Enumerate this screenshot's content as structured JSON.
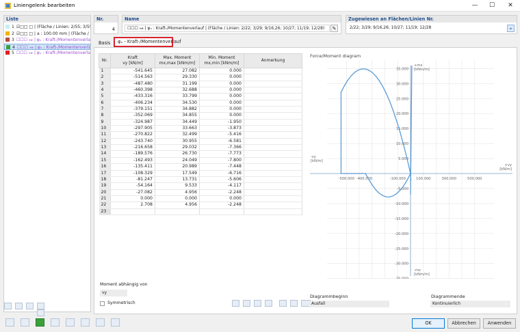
{
  "window": {
    "title": "Liniengelenk bearbeiten",
    "minimize": "—",
    "maximize": "☐",
    "close": "✕"
  },
  "liste": {
    "header": "Liste",
    "items": [
      {
        "nr": "1",
        "text": "☑□□ □ | (Fläche / Linien: 2/55; 3/55; 3/55",
        "color": "#c8f0f0",
        "purple": false
      },
      {
        "nr": "2",
        "text": "☑□□ □ | a : 100.00 mm | (Fläche / Lin",
        "color": "#f0b400",
        "purple": false
      },
      {
        "nr": "3",
        "text": "☐☐☐ 𝓇𝓃 | φₓ : Kraft-/Momentenverlauf",
        "color": "#b84a3e",
        "purple": true
      },
      {
        "nr": "4",
        "text": "☐☐☐ 𝓇𝓃 | φₓ : Kraft-/Momentenverlauf",
        "color": "#3aa03a",
        "purple": true,
        "selected": true
      },
      {
        "nr": "5",
        "text": "☐☐☐ 𝓇𝓃 | φₓ : Kraft-/Momentenverlauf",
        "color": "#e02020",
        "purple": true
      }
    ]
  },
  "nr": {
    "label": "Nr.",
    "value": "4"
  },
  "name": {
    "label": "Name",
    "value": "☐☐☐ 𝓇𝓃 | φₓ : Kraft-/Momentenverlauf | (Fläche / Linien: 2/22; 3/29; 9/16,26; 10/27; 11/19; 12/28)",
    "edit_icon": "✎"
  },
  "assigned": {
    "label": "Zugewiesen an Flächen/Linien Nr.",
    "value": "2/22; 3/29; 9/16,26; 10/27; 11/19; 12/28",
    "pick_icon": "⌖"
  },
  "tabs": {
    "basis": "Basis",
    "kraft": "φₓ - Kraft-/Momentenverlauf"
  },
  "table": {
    "headers": {
      "nr": "Nr.",
      "kraft_top": "Kraft",
      "kraft_unit": "vy [kN/m]",
      "max_top": "Max. Moment",
      "max_unit": "mx,max [kNm/m]",
      "min_top": "Min. Moment",
      "min_unit": "mx,min [kNm/m]",
      "note": "Anmerkung"
    },
    "rows": [
      [
        "1",
        "-541.645",
        "27.082",
        "0.000"
      ],
      [
        "2",
        "-514.563",
        "29.330",
        "0.000"
      ],
      [
        "3",
        "-487.480",
        "31.199",
        "0.000"
      ],
      [
        "4",
        "-460.398",
        "32.688",
        "0.000"
      ],
      [
        "5",
        "-433.316",
        "33.799",
        "0.000"
      ],
      [
        "6",
        "-406.234",
        "34.530",
        "0.000"
      ],
      [
        "7",
        "-379.151",
        "34.882",
        "0.000"
      ],
      [
        "8",
        "-352.069",
        "34.855",
        "0.000"
      ],
      [
        "9",
        "-324.987",
        "34.449",
        "-1.950"
      ],
      [
        "10",
        "-297.905",
        "33.663",
        "-3.873"
      ],
      [
        "11",
        "-270.822",
        "32.499",
        "-5.416"
      ],
      [
        "12",
        "-243.740",
        "30.955",
        "-6.581"
      ],
      [
        "13",
        "-216.658",
        "29.032",
        "-7.366"
      ],
      [
        "14",
        "-189.576",
        "26.730",
        "-7.773"
      ],
      [
        "15",
        "-162.493",
        "24.049",
        "-7.800"
      ],
      [
        "16",
        "-135.411",
        "20.989",
        "-7.448"
      ],
      [
        "17",
        "-108.329",
        "17.549",
        "-6.716"
      ],
      [
        "18",
        "-81.247",
        "13.731",
        "-5.606"
      ],
      [
        "19",
        "-54.164",
        "9.533",
        "-4.117"
      ],
      [
        "20",
        "-27.082",
        "4.956",
        "-2.248"
      ],
      [
        "21",
        "0.000",
        "0.000",
        "0.000"
      ],
      [
        "22",
        "2.708",
        "4.956",
        "-2.248"
      ],
      [
        "23",
        "",
        "",
        ""
      ]
    ]
  },
  "moment": {
    "label": "Moment abhängig von",
    "value": "vy",
    "symmetric_label": "Symmetrisch"
  },
  "diagram": {
    "title": "Force/Moment diagram",
    "xlabel_pos": "+vy\n[kN/m]",
    "xlabel_neg": "-vy\n[kN/m]",
    "ylabel_pos": "+mx\n[kNm/m]",
    "ylabel_neg": "-mx\n[kNm/m]",
    "x_ticks": [
      "-500.000",
      "-400.000",
      "-100.000",
      "100.000",
      "300.000",
      "500.000"
    ],
    "y_ticks": [
      "35.000",
      "30.000",
      "25.000",
      "20.000",
      "15.000",
      "10.000",
      "5.000",
      "-5.000",
      "-10.000",
      "-15.000",
      "-20.000",
      "-25.000",
      "-30.000",
      "-35.000"
    ],
    "line_color": "#5b9bd5"
  },
  "chart_data": {
    "type": "line",
    "title": "Force/Moment diagram",
    "xlabel": "+vy [kN/m]",
    "ylabel": "+mx [kNm/m]",
    "xlim": [
      -650,
      650
    ],
    "ylim": [
      -38,
      38
    ],
    "series": [
      {
        "name": "",
        "x": [
          -541.645,
          -514.563,
          -487.48,
          -460.398,
          -433.316,
          -406.234,
          -379.151,
          -352.069,
          -324.987,
          -297.905,
          -270.822,
          -243.74,
          -216.658,
          -189.576,
          -162.493,
          -135.411,
          -108.329,
          -81.247,
          -54.164,
          -27.082,
          0,
          2.708
        ],
        "values": [
          27.082,
          29.33,
          31.199,
          32.688,
          33.799,
          34.53,
          34.882,
          34.855,
          34.449,
          33.663,
          32.499,
          30.955,
          29.032,
          26.73,
          24.049,
          20.989,
          17.549,
          13.731,
          9.533,
          4.956,
          0,
          4.956
        ]
      },
      {
        "name": "",
        "x": [
          -541.645,
          -514.563,
          -487.48,
          -460.398,
          -433.316,
          -406.234,
          -379.151,
          -352.069,
          -324.987,
          -297.905,
          -270.822,
          -243.74,
          -216.658,
          -189.576,
          -162.493,
          -135.411,
          -108.329,
          -81.247,
          -54.164,
          -27.082,
          0,
          2.708
        ],
        "values": [
          0,
          0,
          0,
          0,
          0,
          0,
          0,
          0,
          -1.95,
          -3.873,
          -5.416,
          -6.581,
          -7.366,
          -7.773,
          -7.8,
          -7.448,
          -6.716,
          -5.606,
          -4.117,
          -2.248,
          0,
          -2.248
        ]
      }
    ]
  },
  "diagrammbeginn": {
    "label": "Diagrammbeginn",
    "value": "Ausfall"
  },
  "diagrammende": {
    "label": "Diagrammende",
    "value": "Kontinuierlich"
  },
  "buttons": {
    "ok": "OK",
    "abbrechen": "Abbrechen",
    "anwenden": "Anwenden"
  }
}
